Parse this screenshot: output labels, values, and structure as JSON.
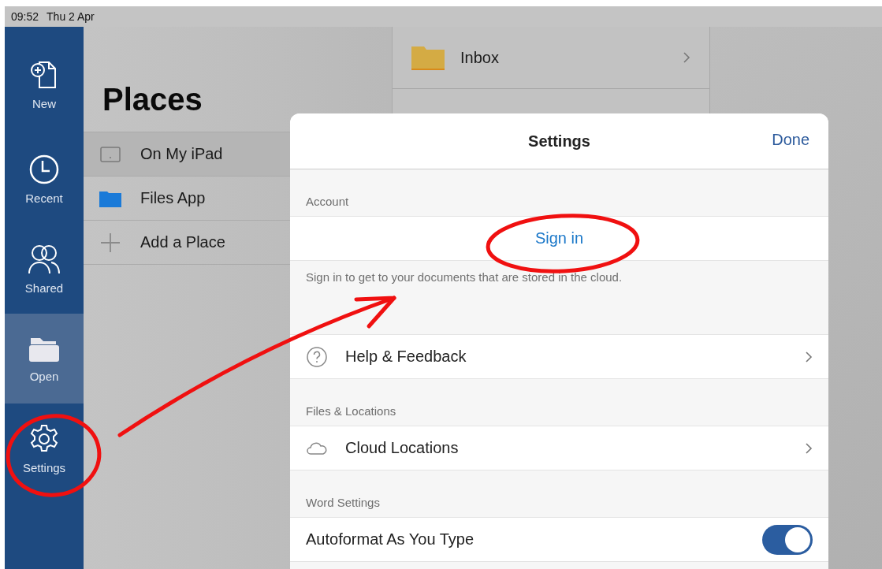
{
  "status_bar": {
    "time": "09:52",
    "date": "Thu 2 Apr"
  },
  "sidebar": {
    "items": [
      {
        "label": "New",
        "selected": false
      },
      {
        "label": "Recent",
        "selected": false
      },
      {
        "label": "Shared",
        "selected": false
      },
      {
        "label": "Open",
        "selected": true
      },
      {
        "label": "Settings",
        "selected": false
      }
    ]
  },
  "places": {
    "title": "Places",
    "items": [
      {
        "label": "On My iPad"
      },
      {
        "label": "Files App"
      },
      {
        "label": "Add a Place"
      }
    ]
  },
  "folders": {
    "items": [
      {
        "label": "Inbox"
      }
    ]
  },
  "settings_dialog": {
    "title": "Settings",
    "done": "Done",
    "sections": [
      {
        "header": "Account",
        "rows": [
          {
            "kind": "action",
            "label": "Sign in"
          }
        ],
        "footer": "Sign in to get to your documents that are stored in the cloud."
      },
      {
        "rows": [
          {
            "kind": "link",
            "label": "Help & Feedback"
          }
        ]
      },
      {
        "header": "Files & Locations",
        "rows": [
          {
            "kind": "link",
            "label": "Cloud Locations"
          }
        ]
      },
      {
        "header": "Word Settings",
        "rows": [
          {
            "kind": "toggle",
            "label": "Autoformat As You Type",
            "on": true
          }
        ]
      }
    ]
  }
}
